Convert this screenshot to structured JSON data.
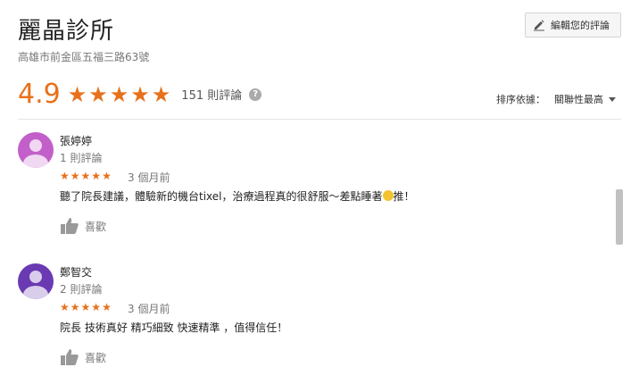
{
  "place": {
    "title": "麗晶診所",
    "address": "高雄市前金區五福三路63號"
  },
  "edit_button": {
    "label": "編輯您的評論",
    "icon": "pencil-icon"
  },
  "summary": {
    "rating": "4.9",
    "stars": 5,
    "review_count": "151 則評論",
    "help_icon": "?"
  },
  "sort": {
    "label": "排序依據：",
    "value": "關聯性最高"
  },
  "colors": {
    "star": "#e7711b",
    "avatar1": "#c25fc9",
    "avatar2": "#6a3ab2"
  },
  "reviews": [
    {
      "name": "張婷婷",
      "review_count": "1 則評論",
      "stars": 5,
      "time": "3 個月前",
      "text_before": "聽了院長建議，體驗新的機台tixel，治療過程真的很舒服～差點睡著",
      "text_after": "推！",
      "like_label": "喜歡"
    },
    {
      "name": "鄭智交",
      "review_count": "2 則評論",
      "stars": 5,
      "time": "3 個月前",
      "text": "院長 技術真好 精巧細致 快速精準 ，值得信任！",
      "like_label": "喜歡"
    }
  ]
}
